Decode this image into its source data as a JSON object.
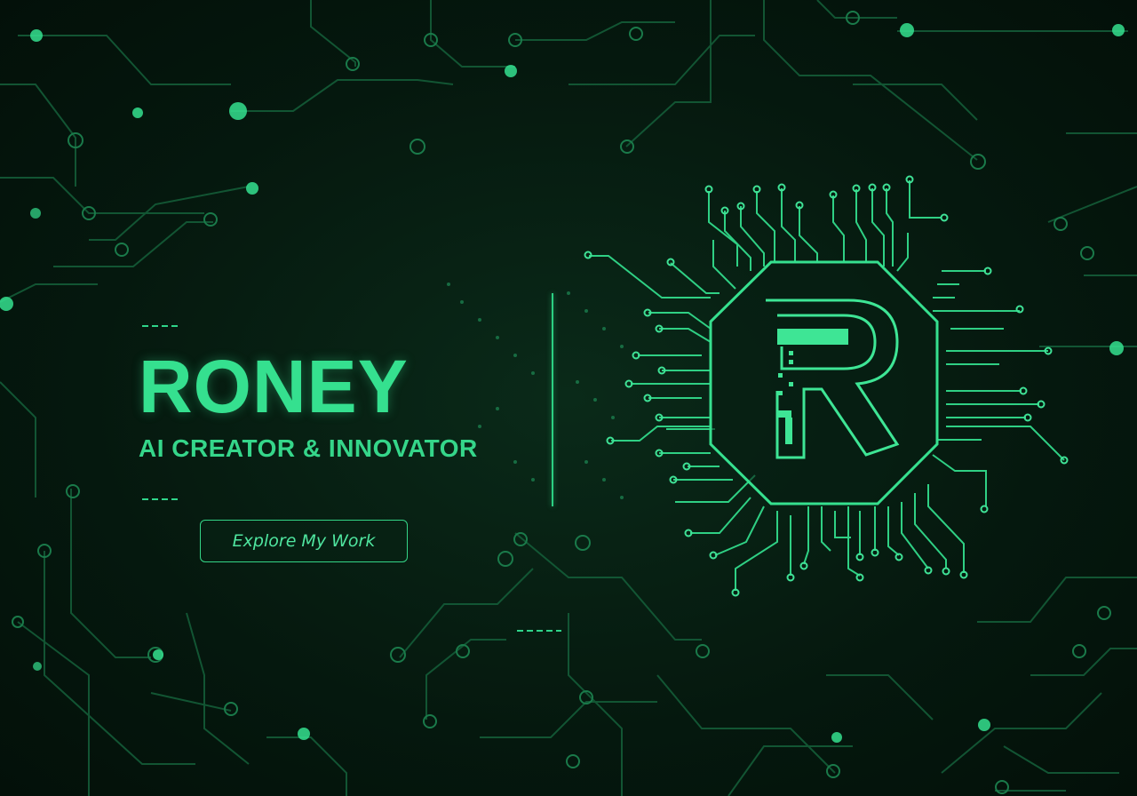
{
  "hero": {
    "title": "RONEY",
    "subtitle": "AI CREATOR & INNOVATOR",
    "cta_label": "Explore My Work"
  },
  "logo": {
    "letter": "R",
    "icon": "chip-r-logo-icon"
  },
  "colors": {
    "background": "#041a10",
    "accent": "#35e08f",
    "trace": "#1f9d62"
  }
}
